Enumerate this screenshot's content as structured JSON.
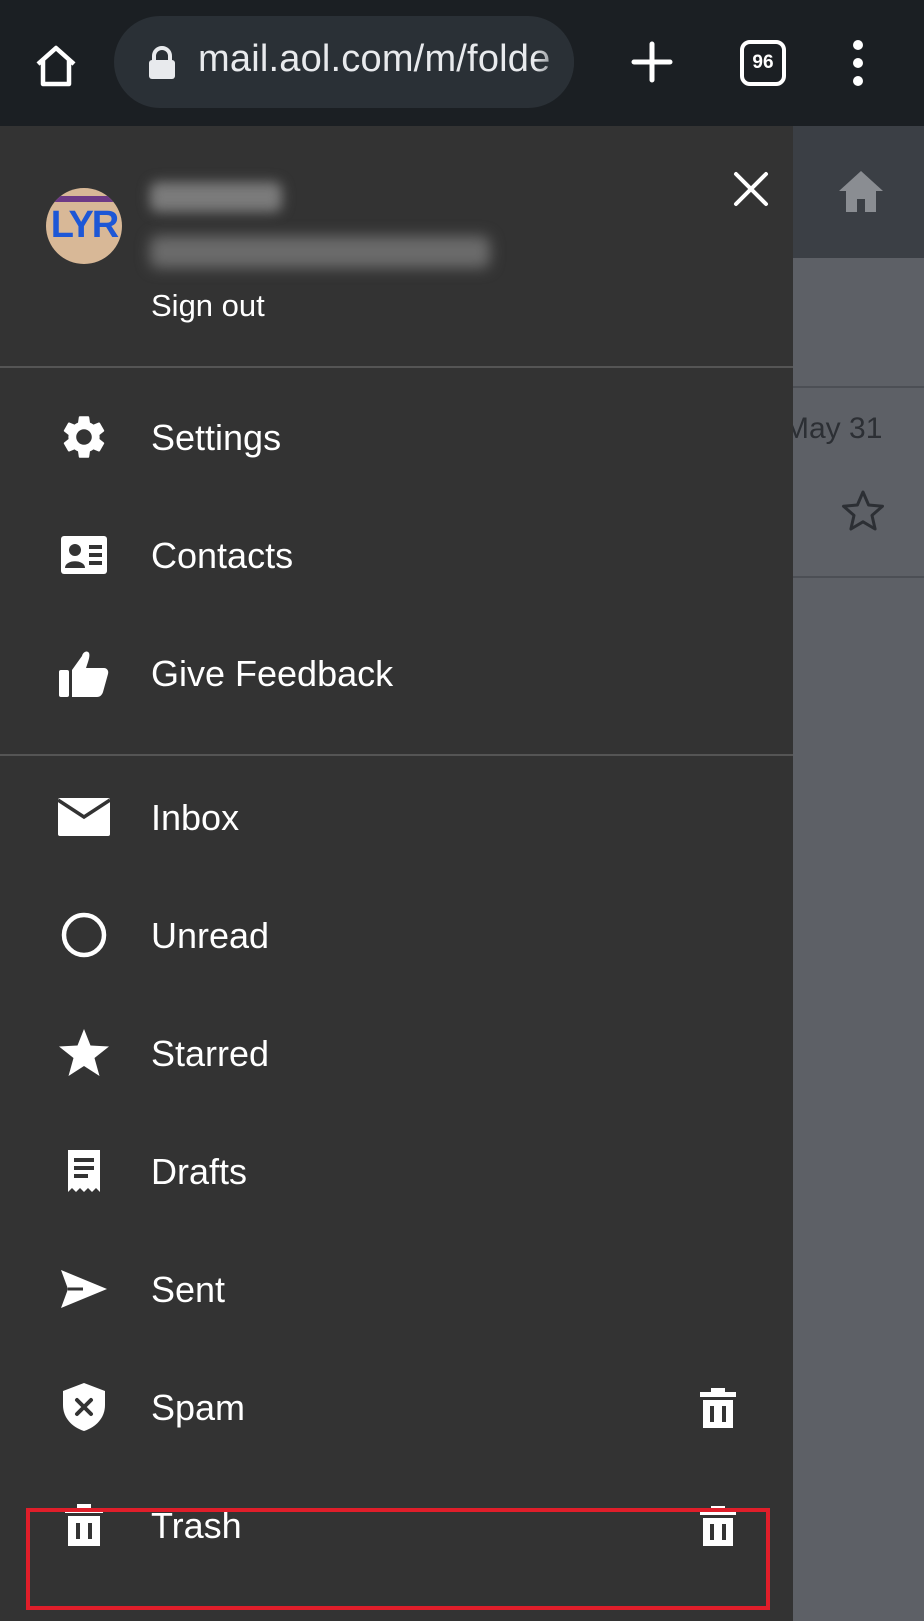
{
  "browser": {
    "url": "mail.aol.com/m/folde",
    "tab_count": "96"
  },
  "background": {
    "date": "May 31"
  },
  "account": {
    "avatar_text": "LYR",
    "sign_out_label": "Sign out"
  },
  "menu": {
    "settings": "Settings",
    "contacts": "Contacts",
    "feedback": "Give Feedback"
  },
  "folders": {
    "inbox": "Inbox",
    "unread": "Unread",
    "starred": "Starred",
    "drafts": "Drafts",
    "sent": "Sent",
    "spam": "Spam",
    "trash": "Trash"
  },
  "colors": {
    "drawer_bg": "#333333",
    "browser_bg": "#1b1f23",
    "highlight": "#e01e2a"
  }
}
